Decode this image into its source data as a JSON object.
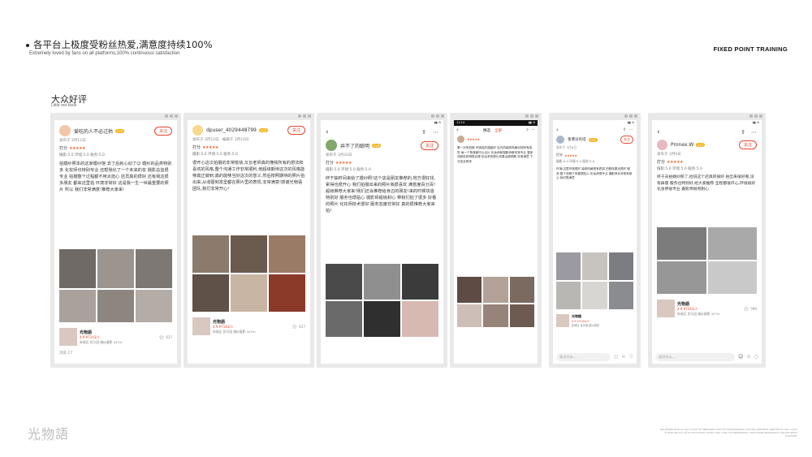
{
  "header": {
    "title": "各平台上极度受粉丝热爱,满意度持续100%",
    "subtitle": "Extremely loved by fans on all platforms,100% continuous satisfaction",
    "brand": "FIXED POINT TRAINING"
  },
  "section": {
    "title": "大众好评",
    "subtitle": "Little red book"
  },
  "cards": [
    {
      "username": "爱吃的人不必过枯",
      "level": "Lv4",
      "follow": "关注",
      "date": "发布于 3月11日",
      "rating_label": "打分",
      "scores": "摄影:5.0  环境:5.0  服务:5.0",
      "text": "拍婚纱照本的这家婚纱馆 去了后就心动了😊 婚纱的品类特别多 化妆师也特别专业 还帮我化了一个未来的妆 摄影总监很专业 拍摄整个过程都不用太担心 店员真的很好 还有我这很多朋友 都来这里拍 环境非常好 这是我一生一世最重要的照片 所以 我们非常满意!推荐大家来!",
      "shop_name": "光物語",
      "shop_rating": "4.9 ¥7143/人",
      "shop_addr": "新城区 民乐园 婚纱摄影 447m",
      "fav_count": "617",
      "footer": "浏览 17"
    },
    {
      "username": "dpuser_4029448799",
      "level": "Lv2",
      "follow": "关注",
      "date": "发布于 3月10日 · 编辑于 3月10日",
      "rating_label": "打分",
      "scores": "摄影:5.0  环境:5.0  服务:5.0",
      "text": "很开心这次拍摄的非常愉快,又长老师真的懂我所有的想法和喜欢的风格,整个沟通工作非常顺利,他超级期待这次的风格能够真正做到,真的能够当好这次的意义,然后按照期待的照片拍出来,从收图到发型都在照片里的表现,非常满意!感谢光物语团队,我们非常开心!",
      "shop_name": "光物語",
      "shop_rating": "4.9 ¥7143/人",
      "shop_addr": "新城区 民乐园 婚纱摄影 447m",
      "fav_count": "617"
    },
    {
      "username": "井不了的聪明",
      "level": "Lv4",
      "follow": "关注",
      "date": "发布于 3月20日",
      "rating_label": "打分",
      "scores": "摄影:5.0  环境:5.0  服务:5.0",
      "text": "终于抽时间来给了婚纱照!这个店是朋友推荐的,地方很好找,累得也很开心 我们拍摄出来的照片我很喜欢 满意度百分百!超级推荐大家来!我们还会推荐给身边的朋友!来的时候妆造特别好 服务也很贴心 摄影师超级耐心 带我们拍了很多 好看的照片 化妆师技术很好 服务态度非常好 真的很推荐大家来拍!",
      "shop_name": "",
      "shop_rating": "",
      "shop_addr": "",
      "fav_count": ""
    },
    {
      "status_time": "11:14",
      "tabs": [
        "精选",
        "全部"
      ],
      "text": "第一次来拍照 环境真的超级好 店内的装修风格也特别有感觉 每一个角落都可以出片 化妆师和摄影师都非常专业 整体流程安排得很合理 拍出来的照片效果远超预期 非常满意 下次还会再来"
    },
    {
      "username": "香港没有塔",
      "level": "Lv3",
      "follow": "关注",
      "date": "发布于 3月6日",
      "rating_label": "打分",
      "scores": "摄影:5.0  环境:5.0  服务:5.0",
      "text": "环境:店里环境很好 装修风格很有质感 拍照效果也很好 服务:整个流程下来都很贴心 化妆师很专业 摄影师也非常有耐心 我们很满意",
      "shop_name": "光物語",
      "shop_rating": "4.9 ¥7143/人",
      "shop_addr": "新城区 民乐园 婚纱摄影",
      "comment_placeholder": "说点什么..."
    },
    {
      "username": "Pronex.W",
      "level": "Lv1",
      "follow": "关注",
      "date": "发布于 3月6日",
      "rating_label": "打分",
      "scores": "摄影:5.0  环境:5.0  服务:5.0",
      "text": "终于去拍婚纱照了,他说这个店真的很好 拍出来很好看,没有踩雷 服务也特别好,给大家推荐 全程都很开心,环境很好 化妆师很专业 摄影师很有耐心",
      "shop_name": "光物語",
      "shop_rating": "4.9 ¥7143/人",
      "shop_addr": "新城区 民乐园 婚纱摄影 447m",
      "fav_count": "590",
      "comment_placeholder": "说点什么..."
    }
  ],
  "footer": {
    "logo": "光物語",
    "logo_sub": "INFINIGHT",
    "note": "THE APPEARANCE OF LIGHT IS NOT SO PERMANENT WITH ITS TRANSPARENCE, AND THE HAPPINESS CREATION OF DAILY LIGHT IS TRUE AND FULL WITH ITS FLAVOUR. SAYING THAT, LOVE YOU PERMANENTLY THAT'S MORE MEANINGFUL THAN DRAMATIC FLAVOURS."
  },
  "colors": {
    "accent": "#e2462d",
    "star": "#f5642a",
    "level": "#f5b31b"
  }
}
